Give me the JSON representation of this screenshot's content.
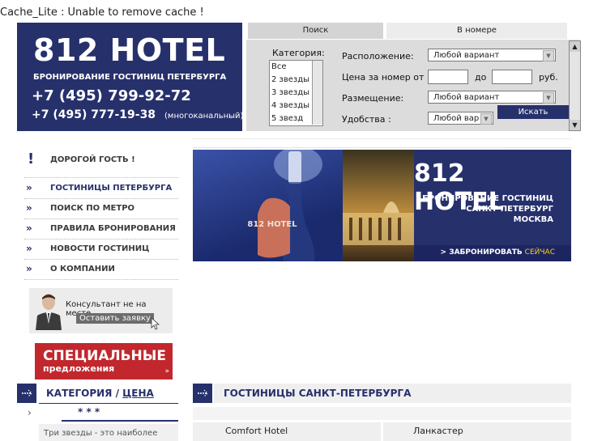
{
  "error_text": "Cache_Lite : Unable to remove cache !",
  "logo": {
    "name": "812 HOTEL",
    "tagline": "БРОНИРОВАНИЕ ГОСТИНИЦ ПЕТЕРБУРГА",
    "phone1": "+7 (495) 799-92-72",
    "phone2": "+7 (495) 777-19-38",
    "phone2_note": "(многоканальный)"
  },
  "search": {
    "tabs": [
      "Поиск",
      "В номере"
    ],
    "category_label": "Категория:",
    "categories": [
      "Все",
      "2 звезды",
      "3 звезды",
      "4 звезды",
      "5 звезд"
    ],
    "location_label": "Расположение:",
    "location_value": "Любой вариант",
    "price_label": "Цена за номер от",
    "price_to": "до",
    "price_unit": "руб.",
    "accommodation_label": "Размещение:",
    "accommodation_value": "Любой вариант",
    "amenities_label": "Удобства :",
    "amenities_value": "Любой вар",
    "search_button": "Искать"
  },
  "nav": {
    "welcome": "ДОРОГОЙ ГОСТЬ !",
    "items": [
      "ГОСТИНИЦЫ ПЕТЕРБУРГА",
      "ПОИСК ПО МЕТРО",
      "ПРАВИЛА БРОНИРОВАНИЯ",
      "НОВОСТИ ГОСТИНИЦ",
      "О КОМПАНИИ"
    ]
  },
  "consultant": {
    "status": "Консультант не на месте",
    "button": "Оставить заявку"
  },
  "promo": {
    "title": "СПЕЦИАЛЬНЫЕ",
    "subtitle": "предложения",
    "arrow": "»"
  },
  "banner": {
    "brand": "812 HOTEL",
    "keytag": "812 HOTEL",
    "line1": "БРОНИРОВАНИЕ ГОСТИНИЦ",
    "line2": "САНКТ-ПЕТЕРБУРГ",
    "line3": "МОСКВА",
    "cta_prefix": "> ЗАБРОНИРОВАТЬ",
    "cta_now": "СЕЙЧАС"
  },
  "category_section": {
    "title_a": "КАТЕГОРИЯ",
    "sep": " / ",
    "title_b": "ЦЕНА",
    "stars": "* * *",
    "arrow": "›",
    "desc": "Три звезды - это наиболее"
  },
  "hotels_section": {
    "title": "ГОСТИНИЦЫ САНКТ-ПЕТЕРБУРГА",
    "hotels": [
      "Comfort Hotel",
      "Ланкастер"
    ]
  }
}
